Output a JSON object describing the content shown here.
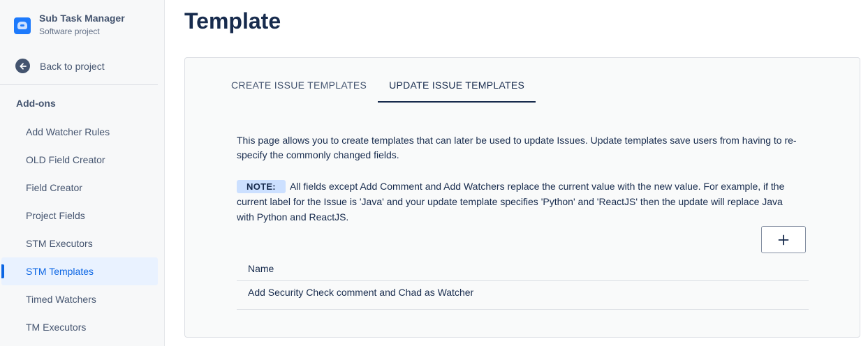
{
  "sidebar": {
    "project_name": "Sub Task Manager",
    "project_type": "Software project",
    "back_label": "Back to project",
    "section_heading": "Add-ons",
    "items": [
      {
        "label": "Add Watcher Rules"
      },
      {
        "label": "OLD Field Creator"
      },
      {
        "label": "Field Creator"
      },
      {
        "label": "Project Fields"
      },
      {
        "label": "STM Executors"
      },
      {
        "label": "STM Templates"
      },
      {
        "label": "Timed Watchers"
      },
      {
        "label": "TM Executors"
      }
    ],
    "active_item": "STM Templates"
  },
  "main": {
    "title": "Template",
    "tabs": [
      {
        "label": "CREATE ISSUE TEMPLATES"
      },
      {
        "label": "UPDATE ISSUE TEMPLATES"
      }
    ],
    "active_tab": "UPDATE ISSUE TEMPLATES",
    "description": "This page allows you to create templates that can later be used to update Issues. Update templates save users from having to re-specify the commonly changed fields.",
    "note_badge": "NOTE:",
    "note_text": "All fields except Add Comment and Add Watchers replace the current value with the new value. For example, if the current label for the Issue is 'Java' and your update template specifies 'Python' and 'ReactJS' then the update will replace Java with Python and ReactJS.",
    "add_button_icon": "plus-icon",
    "table": {
      "header": "Name",
      "rows": [
        {
          "name": "Add Security Check comment and Chad as Watcher"
        }
      ]
    }
  },
  "colors": {
    "accent": "#0c66e4",
    "active_bg": "#e9f2ff",
    "note_badge_bg": "#cce0ff",
    "text": "#172b4d"
  }
}
